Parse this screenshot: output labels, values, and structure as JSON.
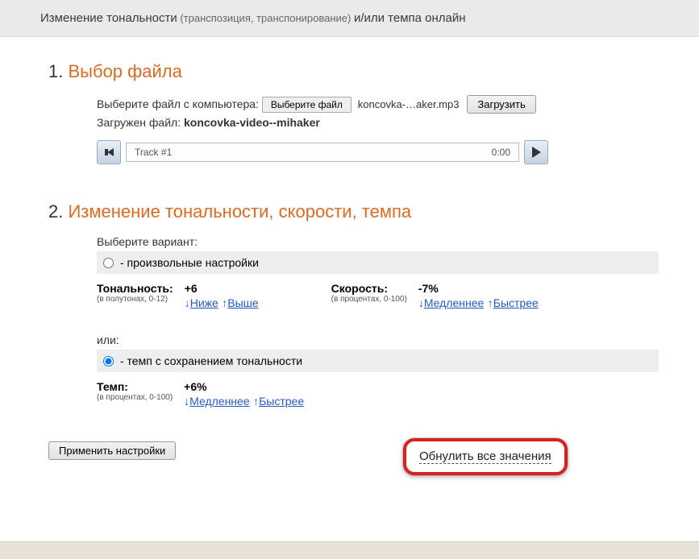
{
  "header": {
    "title_a": "Изменение тональности",
    "title_sub": " (транспозиция, транспонирование) ",
    "title_b": "и/или темпа онлайн"
  },
  "section1": {
    "number": "1.",
    "title": "Выбор файла",
    "select_label": "Выберите файл с компьютера:",
    "choose_btn": "Выберите файл",
    "file_short": "koncovka-…aker.mp3",
    "upload_btn": "Загрузить",
    "loaded_prefix": "Загружен файл: ",
    "loaded_name": "koncovka-video--mihaker",
    "track_label": "Track #1",
    "track_time": "0:00"
  },
  "section2": {
    "number": "2.",
    "title": "Изменение тональности, скорости, темпа",
    "choose_variant": "Выберите вариант:",
    "opt_free": " - произвольные настройки",
    "pitch": {
      "label": "Тональность:",
      "hint": "(в полутонах, 0-12)",
      "value": "+6",
      "lower": "Ниже",
      "higher": "Выше"
    },
    "speed": {
      "label": "Скорость:",
      "hint": "(в процентах, 0-100)",
      "value": "-7%",
      "slower": "Медленнее",
      "faster": "Быстрее"
    },
    "or": "или:",
    "opt_tempo": " - темп с сохранением тональности",
    "tempo": {
      "label": "Темп:",
      "hint": "(в процентах, 0-100)",
      "value": "+6%",
      "slower": "Медленнее",
      "faster": "Быстрее"
    },
    "reset": "Обнулить все значения",
    "apply": "Применить настройки"
  }
}
